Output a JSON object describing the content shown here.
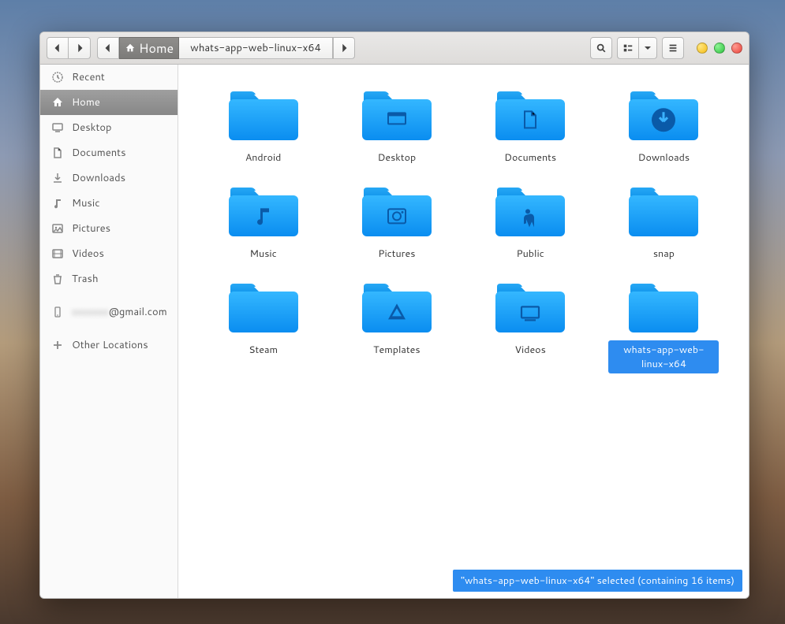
{
  "pathbar": {
    "home": "Home",
    "current": "whats-app-web-linux-x64"
  },
  "sidebar": [
    {
      "icon": "recent",
      "label": "Recent"
    },
    {
      "icon": "home",
      "label": "Home",
      "active": true
    },
    {
      "icon": "desktop",
      "label": "Desktop"
    },
    {
      "icon": "documents",
      "label": "Documents"
    },
    {
      "icon": "downloads",
      "label": "Downloads"
    },
    {
      "icon": "music",
      "label": "Music"
    },
    {
      "icon": "pictures",
      "label": "Pictures"
    },
    {
      "icon": "videos",
      "label": "Videos"
    },
    {
      "icon": "trash",
      "label": "Trash"
    }
  ],
  "sidebar_account": {
    "icon": "phone",
    "blurred": "xxxxxxx",
    "suffix": "@gmail.com"
  },
  "sidebar_other": {
    "icon": "plus",
    "label": "Other Locations"
  },
  "folders": [
    {
      "name": "Android",
      "overlay": null
    },
    {
      "name": "Desktop",
      "overlay": "desktop"
    },
    {
      "name": "Documents",
      "overlay": "documents"
    },
    {
      "name": "Downloads",
      "overlay": "downloads"
    },
    {
      "name": "Music",
      "overlay": "music"
    },
    {
      "name": "Pictures",
      "overlay": "pictures"
    },
    {
      "name": "Public",
      "overlay": "public"
    },
    {
      "name": "snap",
      "overlay": null
    },
    {
      "name": "Steam",
      "overlay": null
    },
    {
      "name": "Templates",
      "overlay": "templates"
    },
    {
      "name": "Videos",
      "overlay": "videos"
    },
    {
      "name": "whats-app-web-linux-x64",
      "overlay": null,
      "selected": true
    }
  ],
  "status": "\"whats-app-web-linux-x64\" selected  (containing 16 items)"
}
